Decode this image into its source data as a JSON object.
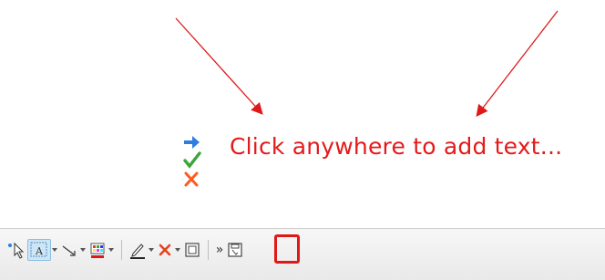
{
  "editor": {
    "placeholder_text": "Click anywhere to add text..."
  },
  "toolbar": {
    "overflow_label": "»",
    "tools": [
      {
        "name": "select-tool",
        "icon": "pointer-icon"
      },
      {
        "name": "text-tool",
        "icon": "text-frame-icon",
        "active": true
      },
      {
        "name": "line-tool",
        "icon": "arrow-line-icon"
      },
      {
        "name": "color-tool",
        "icon": "color-palette-icon"
      },
      {
        "name": "pen-tool",
        "icon": "pen-icon"
      },
      {
        "name": "delete-tool",
        "icon": "x-icon"
      },
      {
        "name": "frame-tool",
        "icon": "image-frame-icon"
      },
      {
        "name": "save-image-tool",
        "icon": "save-image-icon",
        "highlighted": true
      }
    ]
  },
  "colors": {
    "annotation_red": "#e01818",
    "placeholder_red": "#e41a1a",
    "arrow_blue": "#2f7de1",
    "check_green": "#3aa63a",
    "x_orange": "#ff5a1f"
  }
}
